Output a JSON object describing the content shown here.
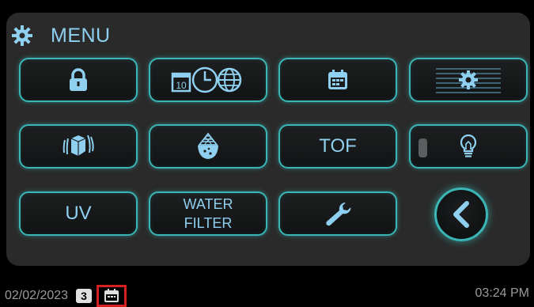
{
  "header": {
    "title": "MENU",
    "icon": "gear-icon"
  },
  "menu": {
    "buttons": [
      {
        "id": "lock",
        "icon": "lock-icon"
      },
      {
        "id": "date-time-region",
        "icon": "clock-globe-icon",
        "icon_text": "10"
      },
      {
        "id": "calendar",
        "icon": "calendar-icon"
      },
      {
        "id": "display-settings",
        "icon": "settings-list-icon"
      },
      {
        "id": "ice-cube",
        "icon": "cube-icon"
      },
      {
        "id": "cup",
        "icon": "cup-icon"
      },
      {
        "id": "tof",
        "label": "TOF"
      },
      {
        "id": "light",
        "icon": "light-bulb-icon",
        "toggle": "off"
      },
      {
        "id": "uv",
        "label": "UV"
      },
      {
        "id": "water-filter",
        "label_line1": "WATER",
        "label_line2": "FILTER"
      },
      {
        "id": "service",
        "icon": "wrench-icon"
      }
    ],
    "back": {
      "icon": "chevron-left-icon"
    }
  },
  "status_bar": {
    "date": "02/02/2023",
    "badge": "3",
    "calendar_icon": "calendar-small-icon",
    "time": "03:24 PM"
  },
  "colors": {
    "accent": "#8fd0f0",
    "border": "#3bb6b7",
    "highlight": "#d42020",
    "panel": "#2a2a2a"
  }
}
